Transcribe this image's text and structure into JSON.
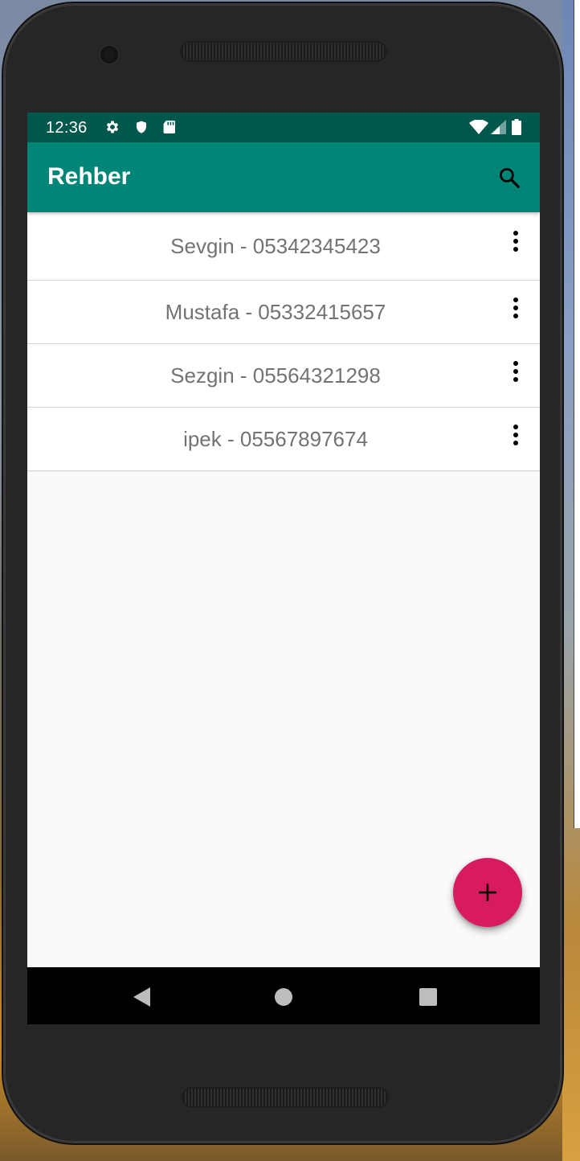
{
  "status_bar": {
    "time": "12:36",
    "left_icons": [
      "settings-icon",
      "shield-icon",
      "sd-card-icon"
    ],
    "right_icons": [
      "wifi-icon",
      "signal-icon",
      "battery-icon"
    ]
  },
  "app_bar": {
    "title": "Rehber",
    "action_icon": "search-icon"
  },
  "contacts": [
    {
      "label": "Sevgin - 05342345423"
    },
    {
      "label": "Mustafa - 05332415657"
    },
    {
      "label": "Sezgin - 05564321298"
    },
    {
      "label": "ipek - 05567897674"
    }
  ],
  "fab": {
    "icon": "plus-icon"
  },
  "nav_bar": {
    "buttons": [
      "back-icon",
      "home-icon",
      "recents-icon"
    ]
  },
  "colors": {
    "status_bar": "#00574b",
    "app_bar": "#008577",
    "fab": "#d81b60",
    "list_text": "#737373"
  }
}
